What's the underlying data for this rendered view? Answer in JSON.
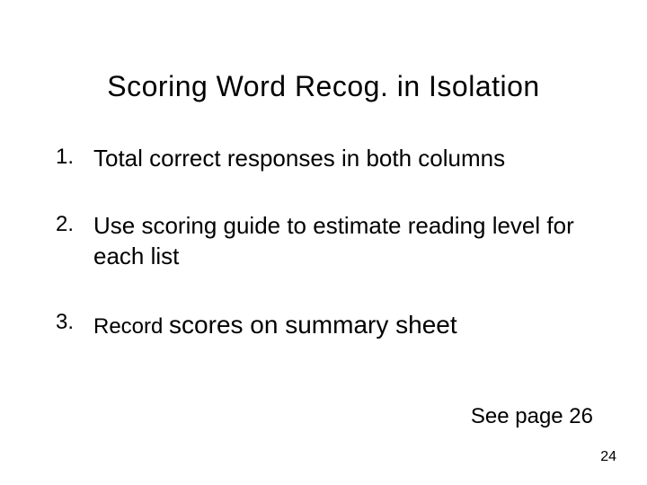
{
  "slide": {
    "title": "Scoring Word Recog. in Isolation",
    "items": [
      {
        "num": "1.",
        "text": "Total correct responses in both columns"
      },
      {
        "num": "2.",
        "text": "Use scoring guide to estimate reading level for each list"
      },
      {
        "num": "3.",
        "pre": "Record ",
        "emph": "scores on summary sheet"
      }
    ],
    "see": "See page 26",
    "page_number": "24"
  }
}
